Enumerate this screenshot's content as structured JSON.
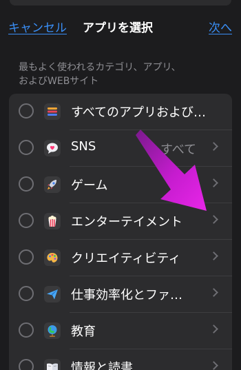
{
  "nav": {
    "cancel_label": "キャンセル",
    "title": "アプリを選択",
    "next_label": "次へ"
  },
  "section": {
    "caption_line1": "最もよく使われるカテゴリ、アプリ、",
    "caption_line2": "およびWEBサイト"
  },
  "categories": [
    {
      "label": "すべてのアプリおよび…",
      "detail": "",
      "chevron": false,
      "icon": "layers-stack-icon"
    },
    {
      "label": "SNS",
      "detail": "すべて",
      "chevron": true,
      "icon": "chat-bubble-heart-icon"
    },
    {
      "label": "ゲーム",
      "detail": "",
      "chevron": true,
      "icon": "rocket-icon"
    },
    {
      "label": "エンターテイメント",
      "detail": "",
      "chevron": true,
      "icon": "popcorn-icon"
    },
    {
      "label": "クリエイティビティ",
      "detail": "",
      "chevron": true,
      "icon": "paint-palette-icon"
    },
    {
      "label": "仕事効率化とファ…",
      "detail": "",
      "chevron": true,
      "icon": "paper-plane-icon"
    },
    {
      "label": "教育",
      "detail": "",
      "chevron": true,
      "icon": "globe-icon"
    },
    {
      "label": "情報と読書",
      "detail": "",
      "chevron": true,
      "icon": "open-book-icon"
    }
  ],
  "colors": {
    "background": "#1c1c1e",
    "cell": "#2c2c2e",
    "accent_blue": "#3a8ff7",
    "annotation_arrow": "#d21fd6"
  }
}
